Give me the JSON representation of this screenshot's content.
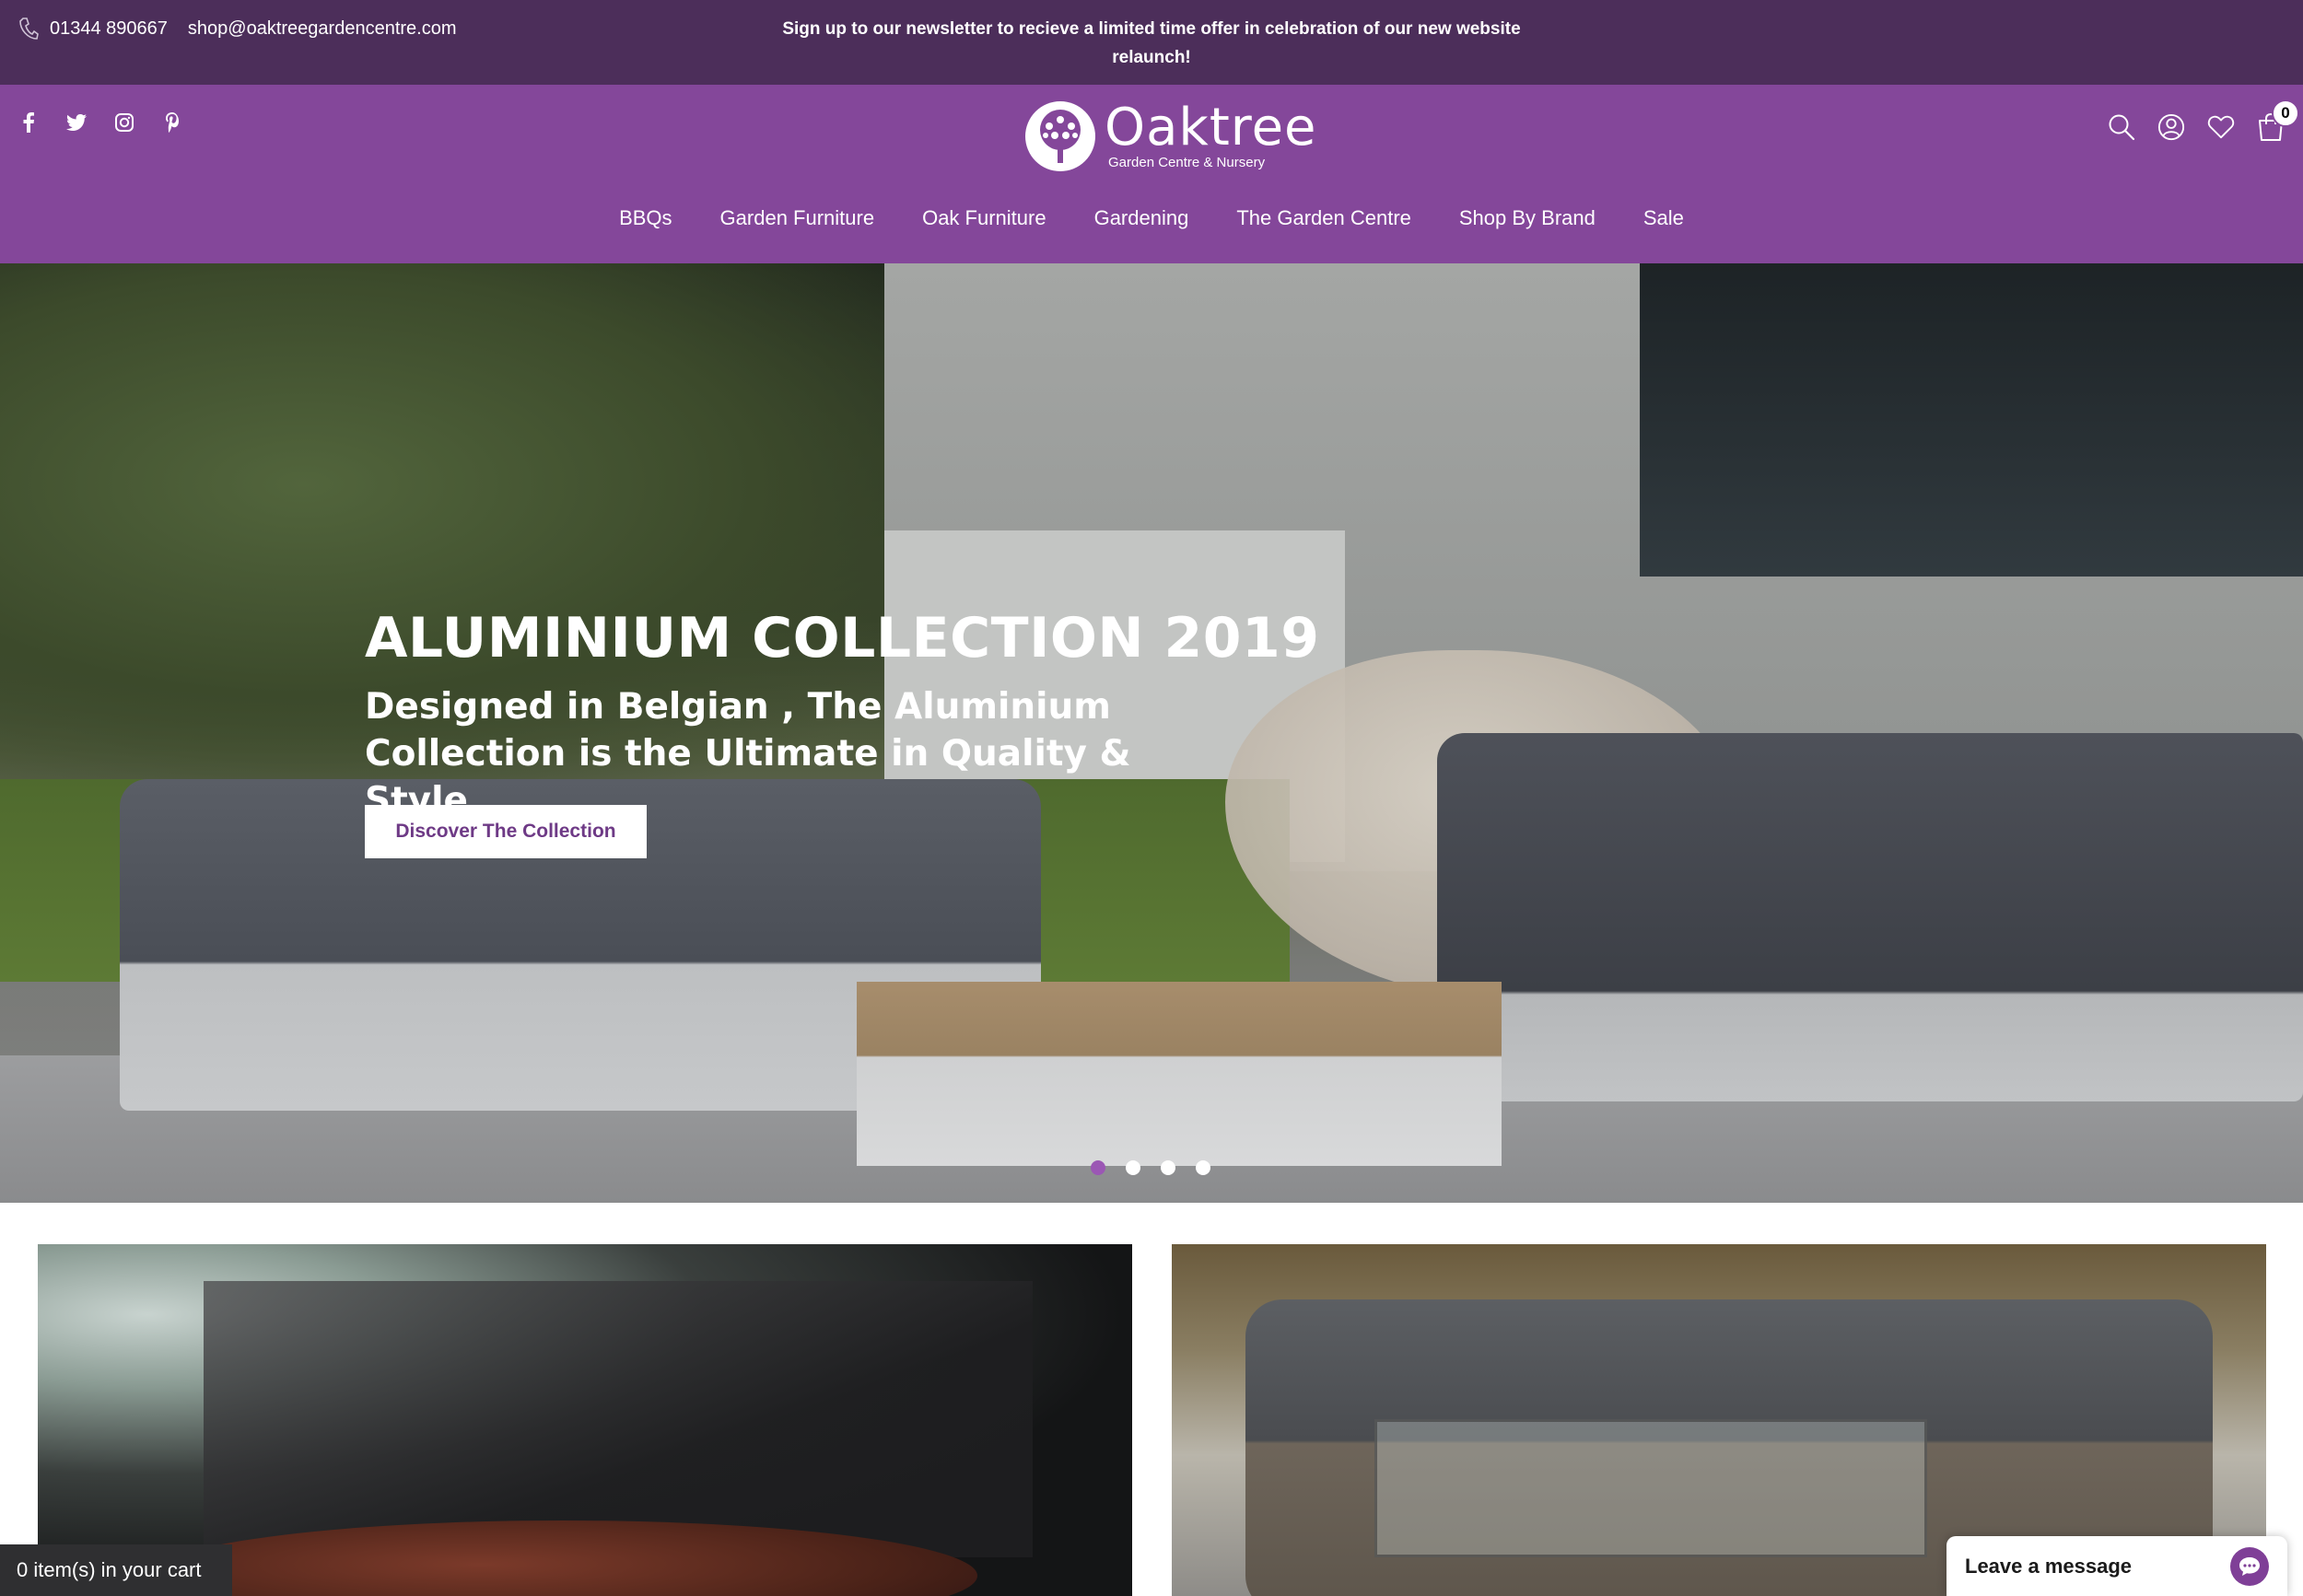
{
  "topbar": {
    "phone": "01344 890667",
    "email": "shop@oaktreegardencentre.com",
    "promo": "Sign up to our newsletter to recieve a limited time offer in celebration of our new website relaunch!"
  },
  "social": [
    "facebook-icon",
    "twitter-icon",
    "instagram-icon",
    "pinterest-icon"
  ],
  "logo": {
    "name": "Oaktree",
    "tagline": "Garden Centre & Nursery"
  },
  "header_icons": [
    "search-icon",
    "account-icon",
    "wishlist-icon",
    "cart-icon"
  ],
  "cart": {
    "count": "0",
    "bar_text": "0 item(s) in your cart"
  },
  "nav": [
    "BBQs",
    "Garden Furniture",
    "Oak Furniture",
    "Gardening",
    "The Garden Centre",
    "Shop By Brand",
    "Sale"
  ],
  "hero": {
    "title": "ALUMINIUM COLLECTION 2019",
    "subtitle": "Designed in Belgian , The Aluminium Collection is the Ultimate in Quality & Style.",
    "button": "Discover The Collection",
    "slides": 4,
    "active_slide": 1
  },
  "chat": {
    "label": "Leave a message"
  },
  "colors": {
    "topbar": "#4c2e5a",
    "header": "#84479a",
    "accent": "#9b57b4",
    "button_text": "#6e3a86"
  }
}
